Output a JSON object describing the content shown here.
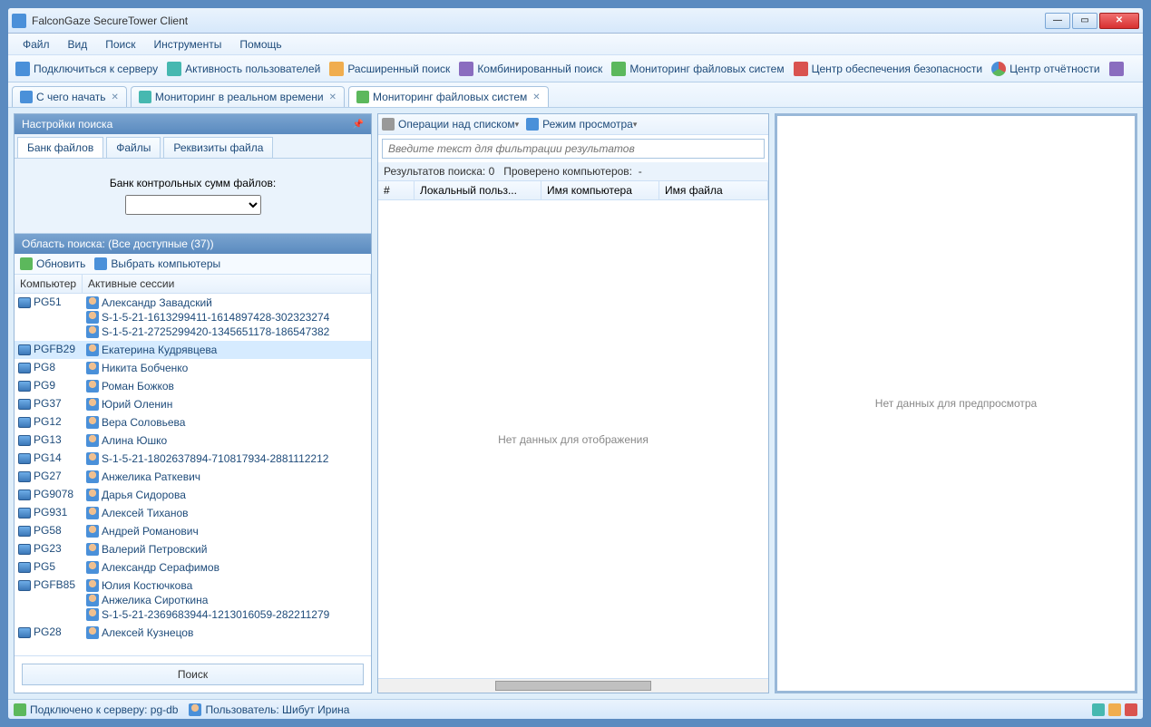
{
  "window": {
    "title": "FalconGaze SecureTower Client"
  },
  "menu": [
    "Файл",
    "Вид",
    "Поиск",
    "Инструменты",
    "Помощь"
  ],
  "toolbar": [
    {
      "label": "Подключиться к серверу",
      "icon": "i-blue"
    },
    {
      "label": "Активность пользователей",
      "icon": "i-teal"
    },
    {
      "label": "Расширенный поиск",
      "icon": "i-orange"
    },
    {
      "label": "Комбинированный поиск",
      "icon": "i-purple"
    },
    {
      "label": "Мониторинг файловых систем",
      "icon": "i-green"
    },
    {
      "label": "Центр обеспечения безопасности",
      "icon": "i-red"
    },
    {
      "label": "Центр отчётности",
      "icon": "i-pie"
    }
  ],
  "doc_tabs": [
    {
      "label": "С чего начать",
      "icon": "i-blue",
      "active": false
    },
    {
      "label": "Мониторинг в реальном времени",
      "icon": "i-teal",
      "active": false
    },
    {
      "label": "Мониторинг файловых систем",
      "icon": "i-green",
      "active": true
    }
  ],
  "search_settings": {
    "title": "Настройки поиска",
    "tabs": [
      "Банк файлов",
      "Файлы",
      "Реквизиты файла"
    ],
    "bank_label": "Банк контрольных сумм файлов:"
  },
  "area": {
    "title": "Область поиска: (Все доступные (37))",
    "refresh": "Обновить",
    "select": "Выбрать компьютеры",
    "col_computer": "Компьютер",
    "col_sessions": "Активные сессии"
  },
  "computers": [
    {
      "name": "PG51",
      "sessions": [
        "Александр Завадский",
        "S-1-5-21-1613299411-1614897428-302323274",
        "S-1-5-21-2725299420-1345651178-186547382"
      ],
      "sel": false
    },
    {
      "name": "PGFB29",
      "sessions": [
        "Екатерина Кудрявцева"
      ],
      "sel": true
    },
    {
      "name": "PG8",
      "sessions": [
        "Никита Бобченко"
      ],
      "sel": false
    },
    {
      "name": "PG9",
      "sessions": [
        "Роман Божков"
      ],
      "sel": false
    },
    {
      "name": "PG37",
      "sessions": [
        "Юрий Оленин"
      ],
      "sel": false
    },
    {
      "name": "PG12",
      "sessions": [
        "Вера Соловьева"
      ],
      "sel": false
    },
    {
      "name": "PG13",
      "sessions": [
        "Алина Юшко"
      ],
      "sel": false
    },
    {
      "name": "PG14",
      "sessions": [
        "S-1-5-21-1802637894-710817934-2881112212"
      ],
      "sel": false
    },
    {
      "name": "PG27",
      "sessions": [
        "Анжелика Раткевич"
      ],
      "sel": false
    },
    {
      "name": "PG9078",
      "sessions": [
        "Дарья Сидорова"
      ],
      "sel": false
    },
    {
      "name": "PG931",
      "sessions": [
        "Алексей Тиханов"
      ],
      "sel": false
    },
    {
      "name": "PG58",
      "sessions": [
        "Андрей Романович"
      ],
      "sel": false
    },
    {
      "name": "PG23",
      "sessions": [
        "Валерий Петровский"
      ],
      "sel": false
    },
    {
      "name": "PG5",
      "sessions": [
        "Александр Серафимов"
      ],
      "sel": false
    },
    {
      "name": "PGFB85",
      "sessions": [
        "Юлия Костючкова",
        "Анжелика Сироткина",
        "S-1-5-21-2369683944-1213016059-282211279"
      ],
      "sel": false
    },
    {
      "name": "PG28",
      "sessions": [
        "Алексей Кузнецов"
      ],
      "sel": false
    }
  ],
  "search_button": "Поиск",
  "mid": {
    "op_list": "Операции над списком",
    "view_mode": "Режим просмотра",
    "filter_placeholder": "Введите текст для фильтрации результатов",
    "results_label": "Результатов поиска:",
    "results_count": "0",
    "checked_label": "Проверено компьютеров:",
    "checked_value": "-",
    "cols": [
      "#",
      "Локальный польз...",
      "Имя компьютера",
      "Имя файла"
    ],
    "empty": "Нет данных для отображения"
  },
  "preview_empty": "Нет данных для предпросмотра",
  "status": {
    "connected": "Подключено к серверу: pg-db",
    "user": "Пользователь: Шибут Ирина"
  }
}
